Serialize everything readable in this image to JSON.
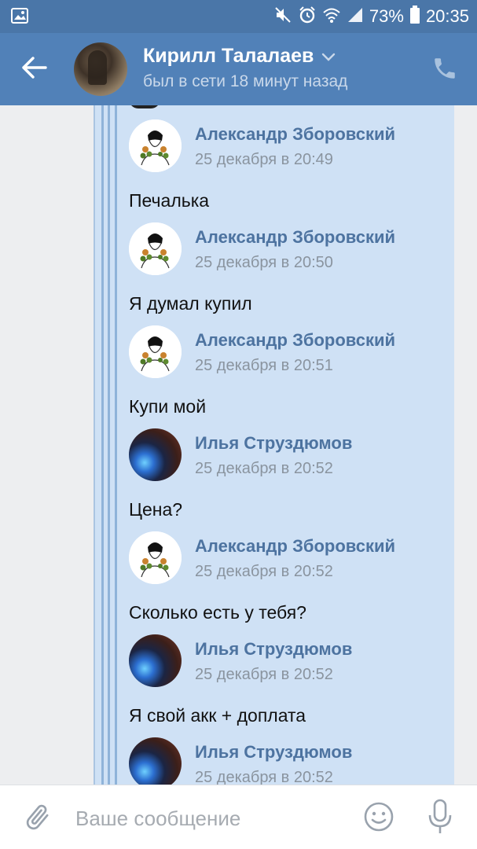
{
  "status_bar": {
    "battery": "73%",
    "time": "20:35",
    "icons": [
      "image-notification-icon",
      "mute-icon",
      "alarm-icon",
      "wifi-icon",
      "signal-icon",
      "battery-icon"
    ]
  },
  "header": {
    "name": "Кирилл Талалаев",
    "status": "был в сети 18 минут назад",
    "icons": [
      "back-arrow-icon",
      "chevron-down-icon",
      "phone-icon"
    ]
  },
  "messages": [
    {
      "author": "Александр Зборовский",
      "time": "25 декабря в 20:49",
      "text": "Печалька",
      "avatar": "alex"
    },
    {
      "author": "Александр Зборовский",
      "time": "25 декабря в 20:50",
      "text": "Я думал купил",
      "avatar": "alex"
    },
    {
      "author": "Александр Зборовский",
      "time": "25 декабря в 20:51",
      "text": "Купи мой",
      "avatar": "alex"
    },
    {
      "author": "Илья Струздюмов",
      "time": "25 декабря в 20:52",
      "text": "Цена?",
      "avatar": "ilya"
    },
    {
      "author": "Александр Зборовский",
      "time": "25 декабря в 20:52",
      "text": "Сколько есть у тебя?",
      "avatar": "alex"
    },
    {
      "author": "Илья Струздюмов",
      "time": "25 декабря в 20:52",
      "text": "Я свой акк + доплата",
      "avatar": "ilya"
    },
    {
      "author": "Илья Струздюмов",
      "time": "25 декабря в 20:52",
      "text": "",
      "avatar": "ilya"
    }
  ],
  "input": {
    "placeholder": "Ваше сообщение",
    "value": "",
    "icons": [
      "paperclip-icon",
      "emoji-icon",
      "microphone-icon"
    ]
  },
  "colors": {
    "header_bg": "#5181b8",
    "status_bar_bg": "#4a76a8",
    "forward_bubble_bg": "#cfe1f5",
    "author_link": "#4d73a0"
  }
}
